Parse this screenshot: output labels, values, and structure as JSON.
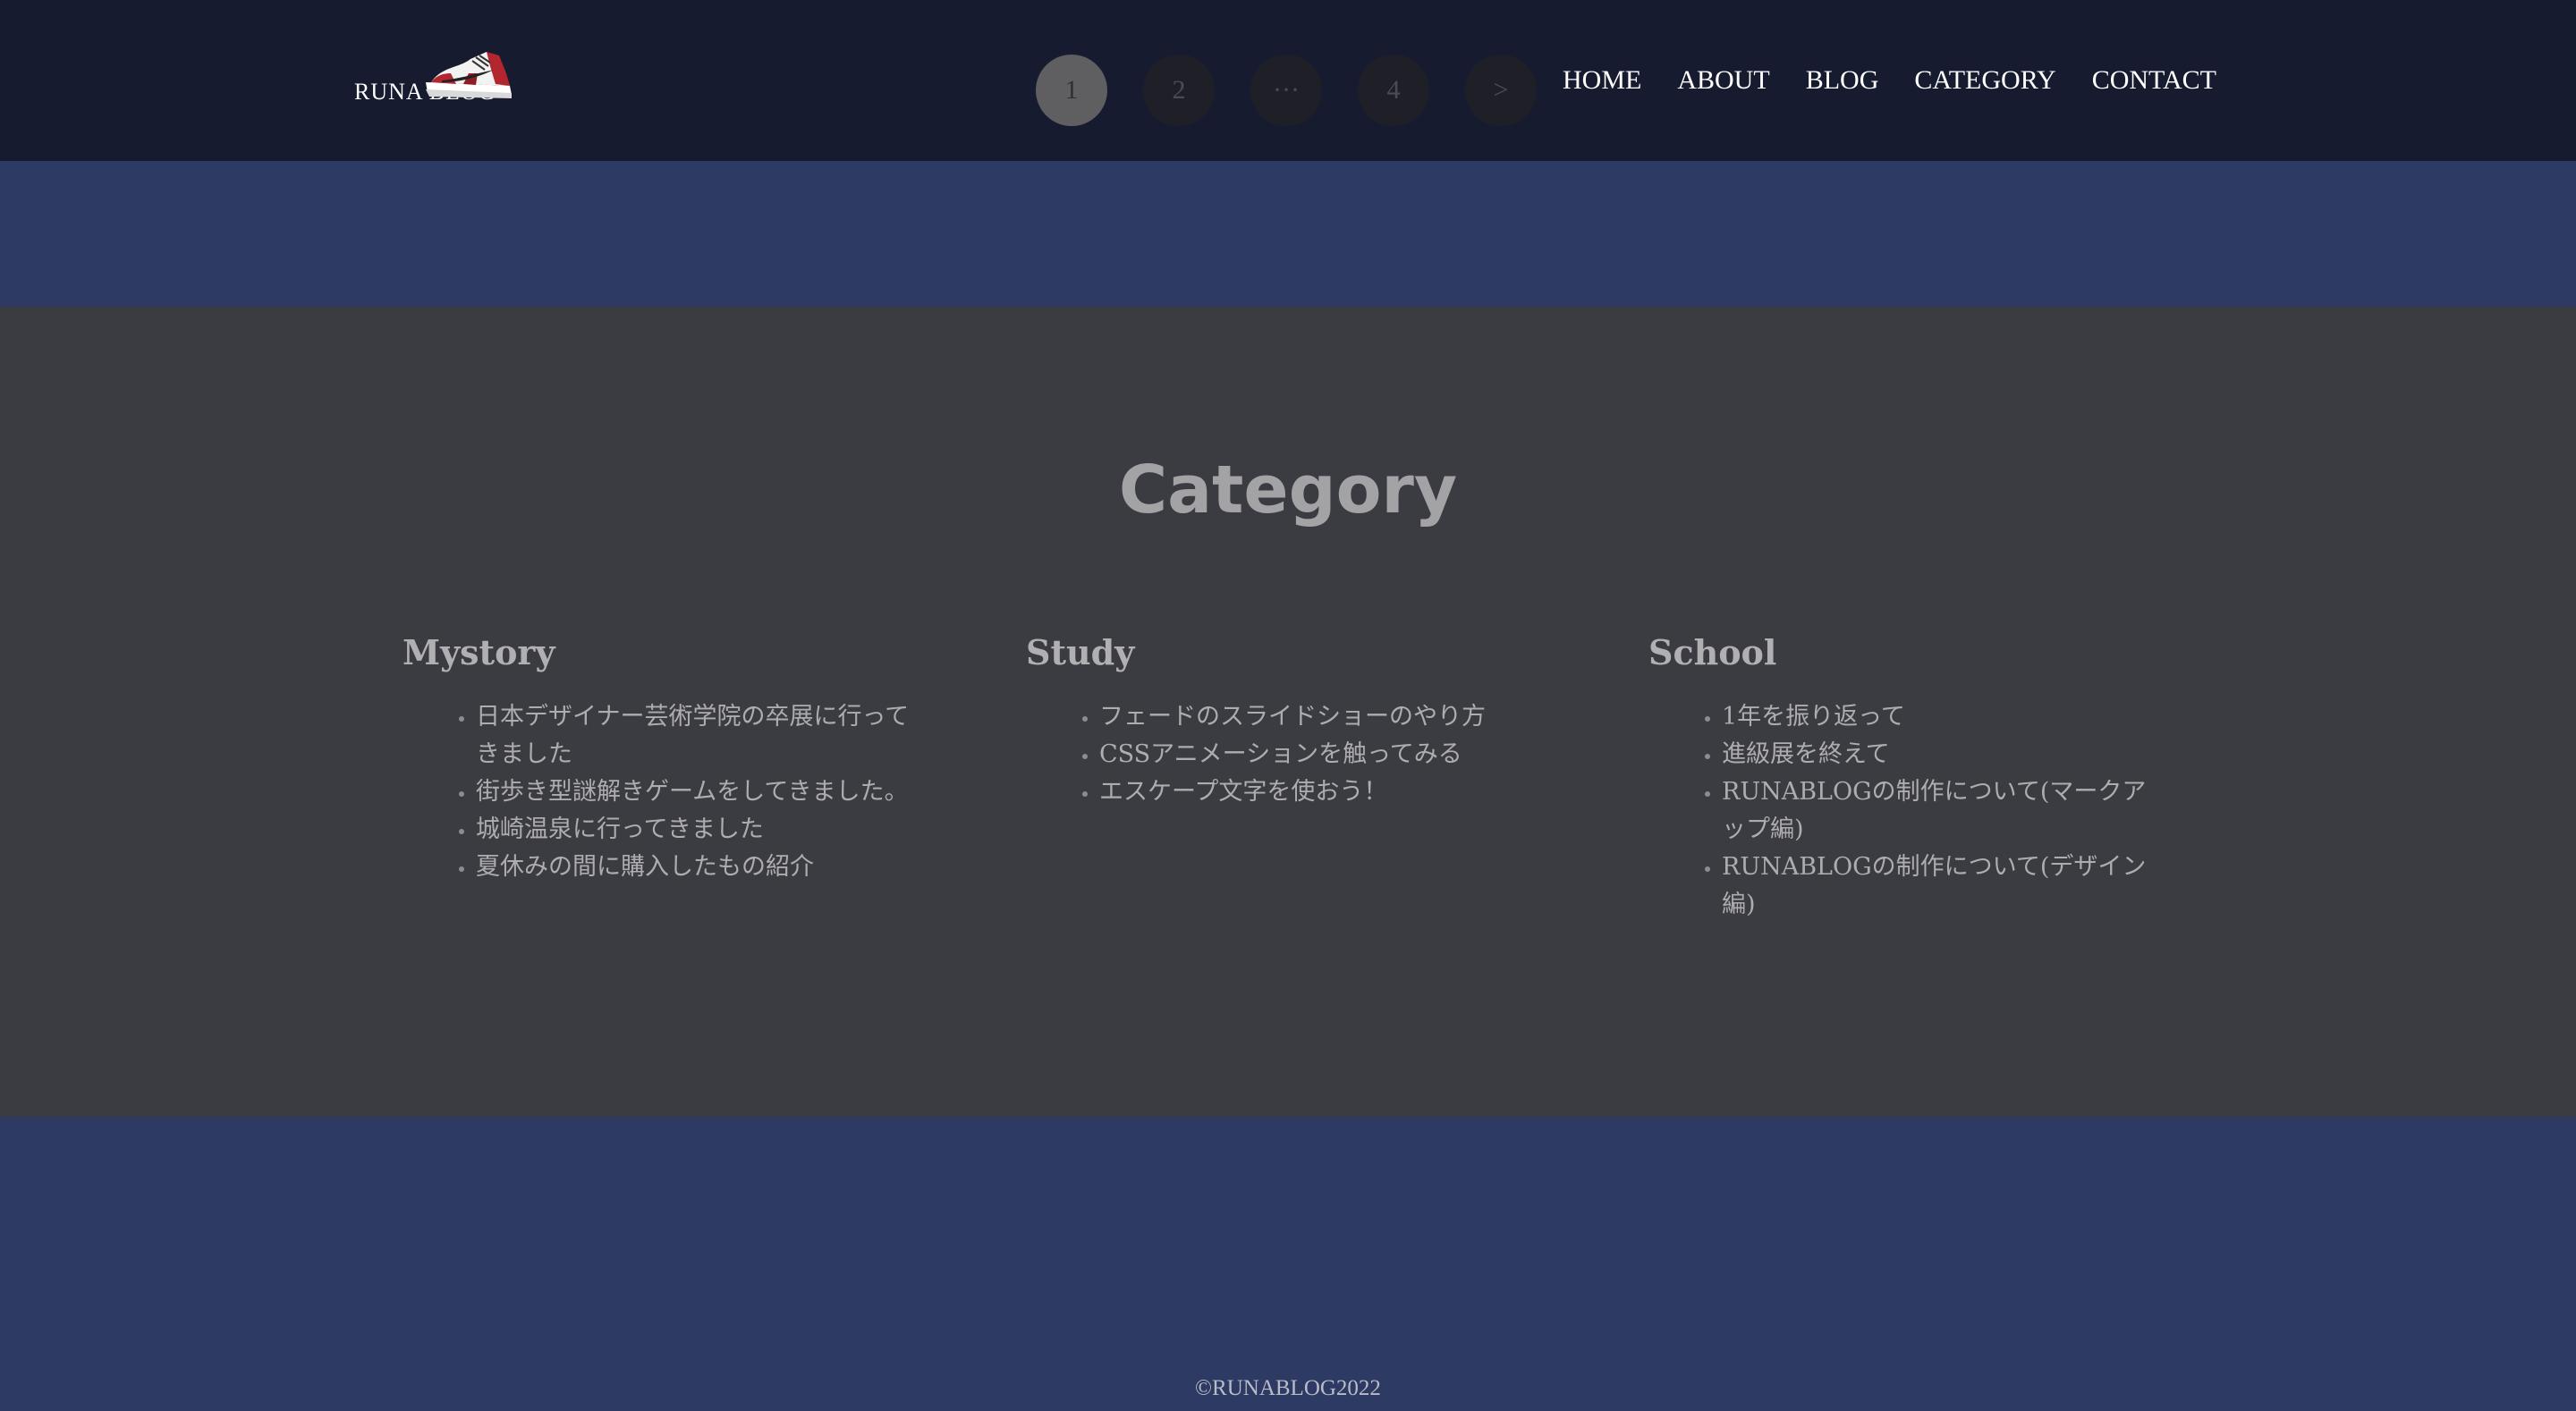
{
  "header": {
    "logo_text": "RUNA BLOG",
    "logo_icon": "sneaker-icon",
    "pagination": [
      {
        "label": "1",
        "active": true
      },
      {
        "label": "2",
        "active": false
      },
      {
        "label": "···",
        "active": false
      },
      {
        "label": "4",
        "active": false
      },
      {
        "label": ">",
        "active": false
      }
    ],
    "nav": [
      "HOME",
      "ABOUT",
      "BLOG",
      "CATEGORY",
      "CONTACT"
    ]
  },
  "main": {
    "title": "Category",
    "columns": [
      {
        "title": "Mystory",
        "items": [
          "日本デザイナー芸術学院の卒展に行ってきました",
          "街歩き型謎解きゲームをしてきました。",
          "城崎温泉に行ってきました",
          "夏休みの間に購入したもの紹介"
        ]
      },
      {
        "title": "Study",
        "items": [
          "フェードのスライドショーのやり方",
          "CSSアニメーションを触ってみる",
          "エスケープ文字を使おう！"
        ]
      },
      {
        "title": "School",
        "items": [
          "1年を振り返って",
          "進級展を終えて",
          "RUNABLOGの制作について(マークアップ編)",
          "RUNABLOGの制作について(デザイン編)"
        ]
      }
    ]
  },
  "footer": {
    "copyright": "©RUNABLOG2022"
  },
  "colors": {
    "header_bg": "#161b30",
    "band_bg": "#2d3a63",
    "main_bg": "#3b3b42",
    "page_active": "#5f5f62",
    "page_inactive": "#1f2027"
  }
}
